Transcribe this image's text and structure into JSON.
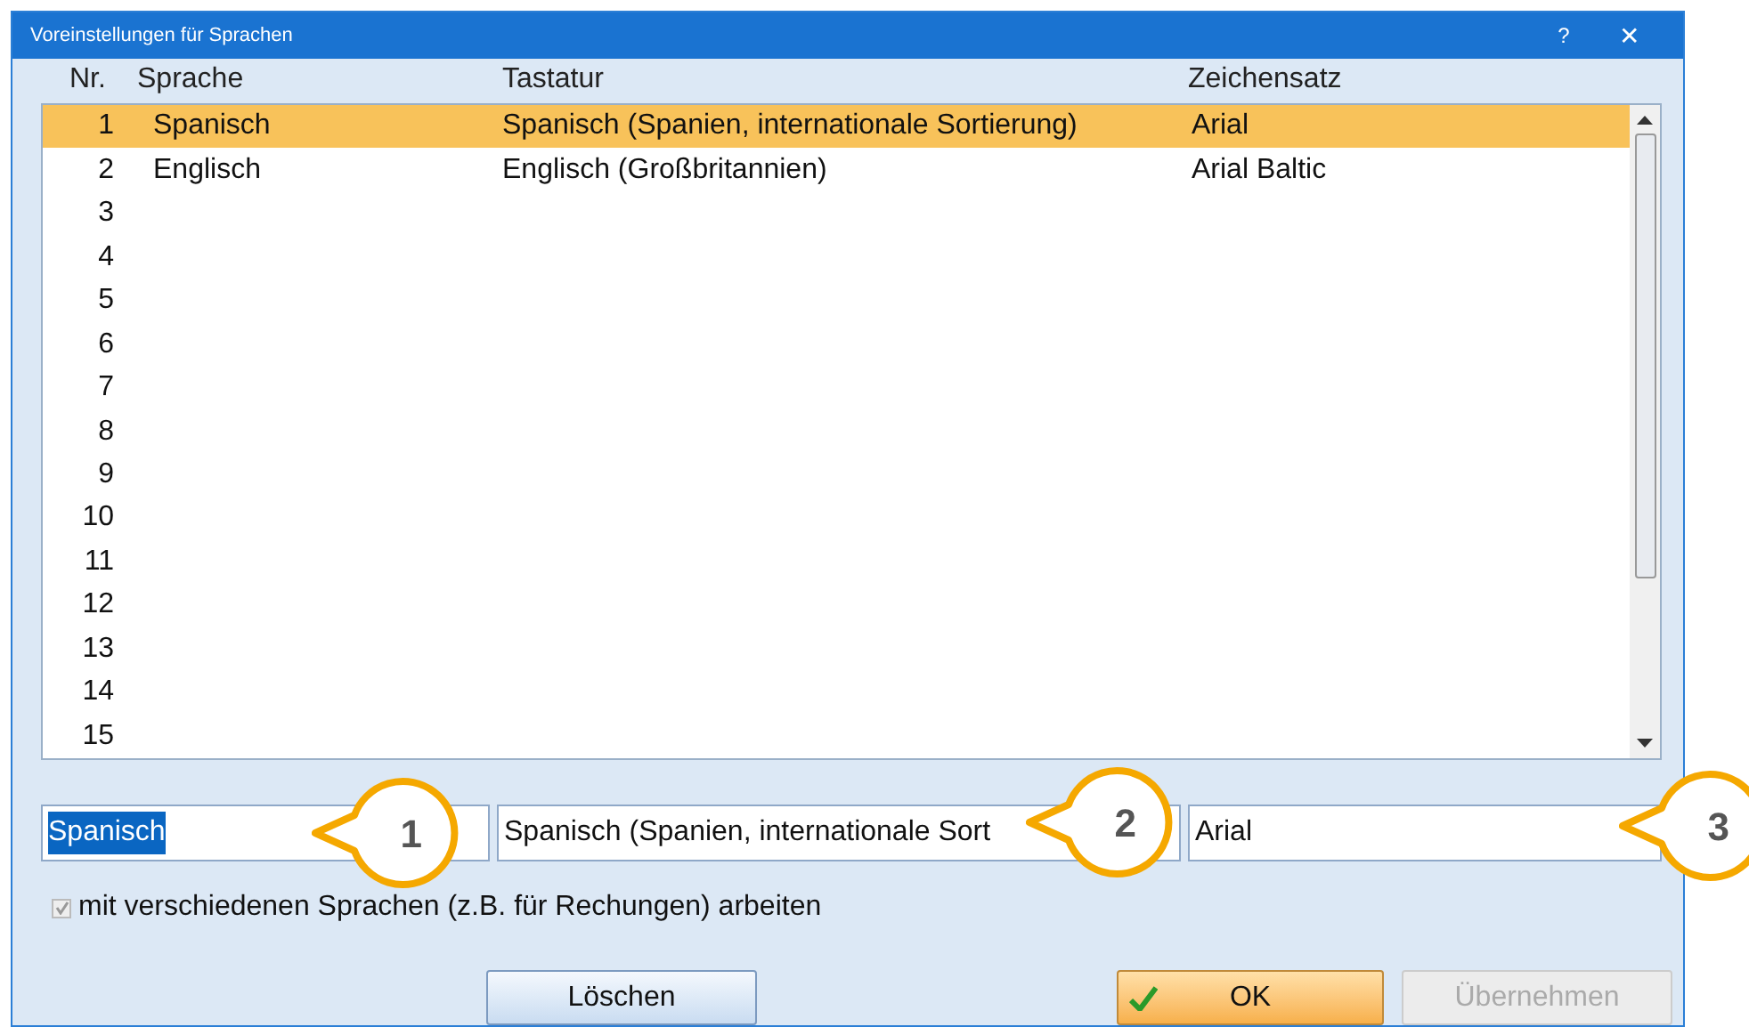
{
  "window": {
    "title": "Voreinstellungen für Sprachen",
    "help": "?",
    "close": "✕"
  },
  "table": {
    "columns": [
      "Nr.",
      "Sprache",
      "Tastatur",
      "Zeichensatz"
    ],
    "rows": [
      {
        "nr": "1",
        "sprache": "Spanisch",
        "tastatur": "Spanisch (Spanien, internationale Sortierung)",
        "zeichensatz": "Arial",
        "selected": true
      },
      {
        "nr": "2",
        "sprache": "Englisch",
        "tastatur": "Englisch (Großbritannien)",
        "zeichensatz": "Arial Baltic",
        "selected": false
      },
      {
        "nr": "3",
        "selected": false
      },
      {
        "nr": "4",
        "selected": false
      },
      {
        "nr": "5",
        "selected": false
      },
      {
        "nr": "6",
        "selected": false
      },
      {
        "nr": "7",
        "selected": false
      },
      {
        "nr": "8",
        "selected": false
      },
      {
        "nr": "9",
        "selected": false
      },
      {
        "nr": "10",
        "selected": false
      },
      {
        "nr": "11",
        "selected": false
      },
      {
        "nr": "12",
        "selected": false
      },
      {
        "nr": "13",
        "selected": false
      },
      {
        "nr": "14",
        "selected": false
      },
      {
        "nr": "15",
        "selected": false
      }
    ]
  },
  "fields": [
    {
      "value": "Spanisch",
      "selected_text": true
    },
    {
      "value": "Spanisch (Spanien, internationale Sort",
      "selected_text": false
    },
    {
      "value": "Arial",
      "selected_text": false
    }
  ],
  "checkbox": {
    "label": "mit verschiedenen Sprachen (z.B. für Rechungen) arbeiten",
    "checked": true,
    "disabled": true
  },
  "buttons": [
    {
      "label": "Löschen",
      "kind": "plain",
      "disabled": false
    },
    {
      "label": "OK",
      "kind": "ok",
      "disabled": false
    },
    {
      "label": "Übernehmen",
      "kind": "plain",
      "disabled": true
    }
  ],
  "callouts": [
    "1",
    "2",
    "3"
  ]
}
